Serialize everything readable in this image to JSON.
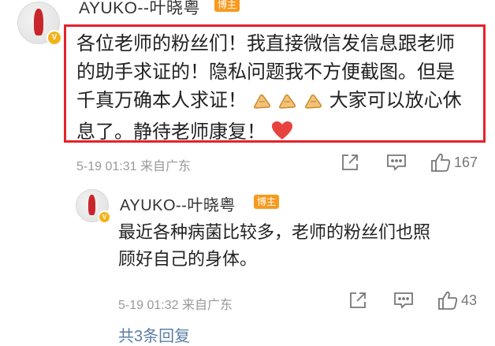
{
  "comment": {
    "username": "AYUKO--叶晓粤",
    "tag": "博主",
    "text_lines": [
      "各位老师的粉丝们！我直接微信发信息跟老师",
      "的助手求证的！隐私问题我不方便截图。但是",
      "千真万确本人求证！",
      " 大家可以放心休",
      "息了。静待老师康复！"
    ],
    "timestamp": "5-19 01:31 来自广东",
    "like_count": "167"
  },
  "reply": {
    "username": "AYUKO--叶晓粤",
    "tag": "博主",
    "text_lines": [
      "最近各种病菌比较多，老师的粉丝们也照",
      "顾好自己的身体。"
    ],
    "timestamp": "5-19 01:32 来自广东",
    "like_count": "43"
  },
  "more_replies": "共3条回复",
  "colors": {
    "highlight_border": "#e5222b",
    "tag_bg": "#f79a1f",
    "heart": "#e8423f",
    "link": "#5b7fa6"
  },
  "icons": [
    "share-icon",
    "comment-icon",
    "like-icon",
    "clap-emoji-icon",
    "heart-emoji-icon",
    "verified-badge-icon"
  ]
}
